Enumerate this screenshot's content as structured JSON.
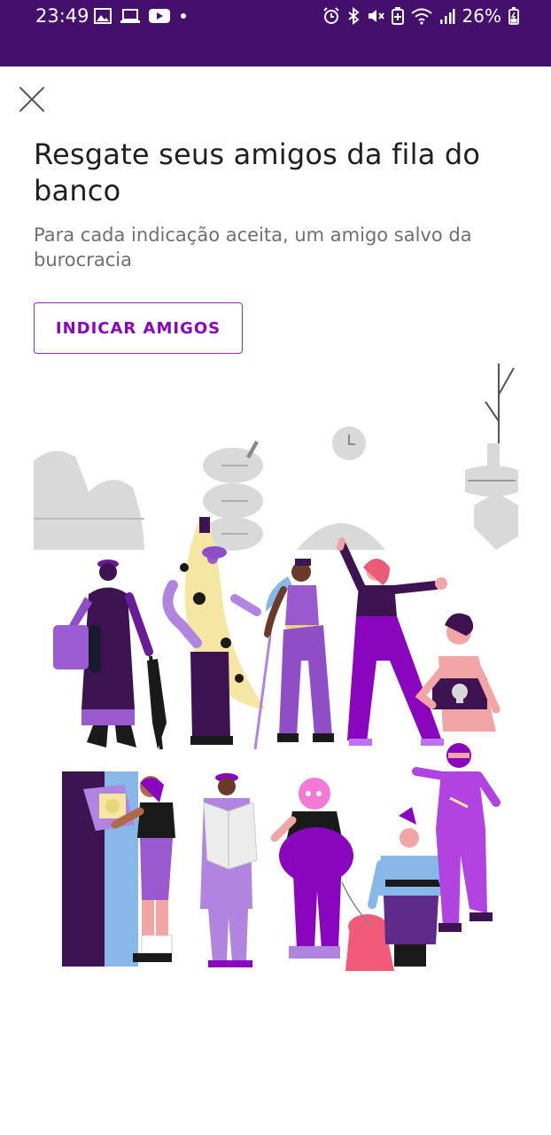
{
  "status_bar": {
    "time": "23:49",
    "battery": "26%",
    "left_icons": [
      "image-icon",
      "laptop-icon",
      "youtube-icon",
      "dot-icon"
    ],
    "right_icons": [
      "alarm-icon",
      "bluetooth-icon",
      "mute-icon",
      "battery-saver-icon",
      "wifi-icon",
      "signal-icon",
      "battery-icon"
    ],
    "background": "#45106b"
  },
  "screen": {
    "close_icon": "close-icon",
    "title": "Resgate seus amigos da fila do banco",
    "subtitle": "Para cada indicação aceita, um amigo salvo da burocracia",
    "invite_button": "INDICAR AMIGOS",
    "accent_color": "#8a05be"
  },
  "illustration": {
    "description_icon": "people-in-queue-illustration"
  }
}
